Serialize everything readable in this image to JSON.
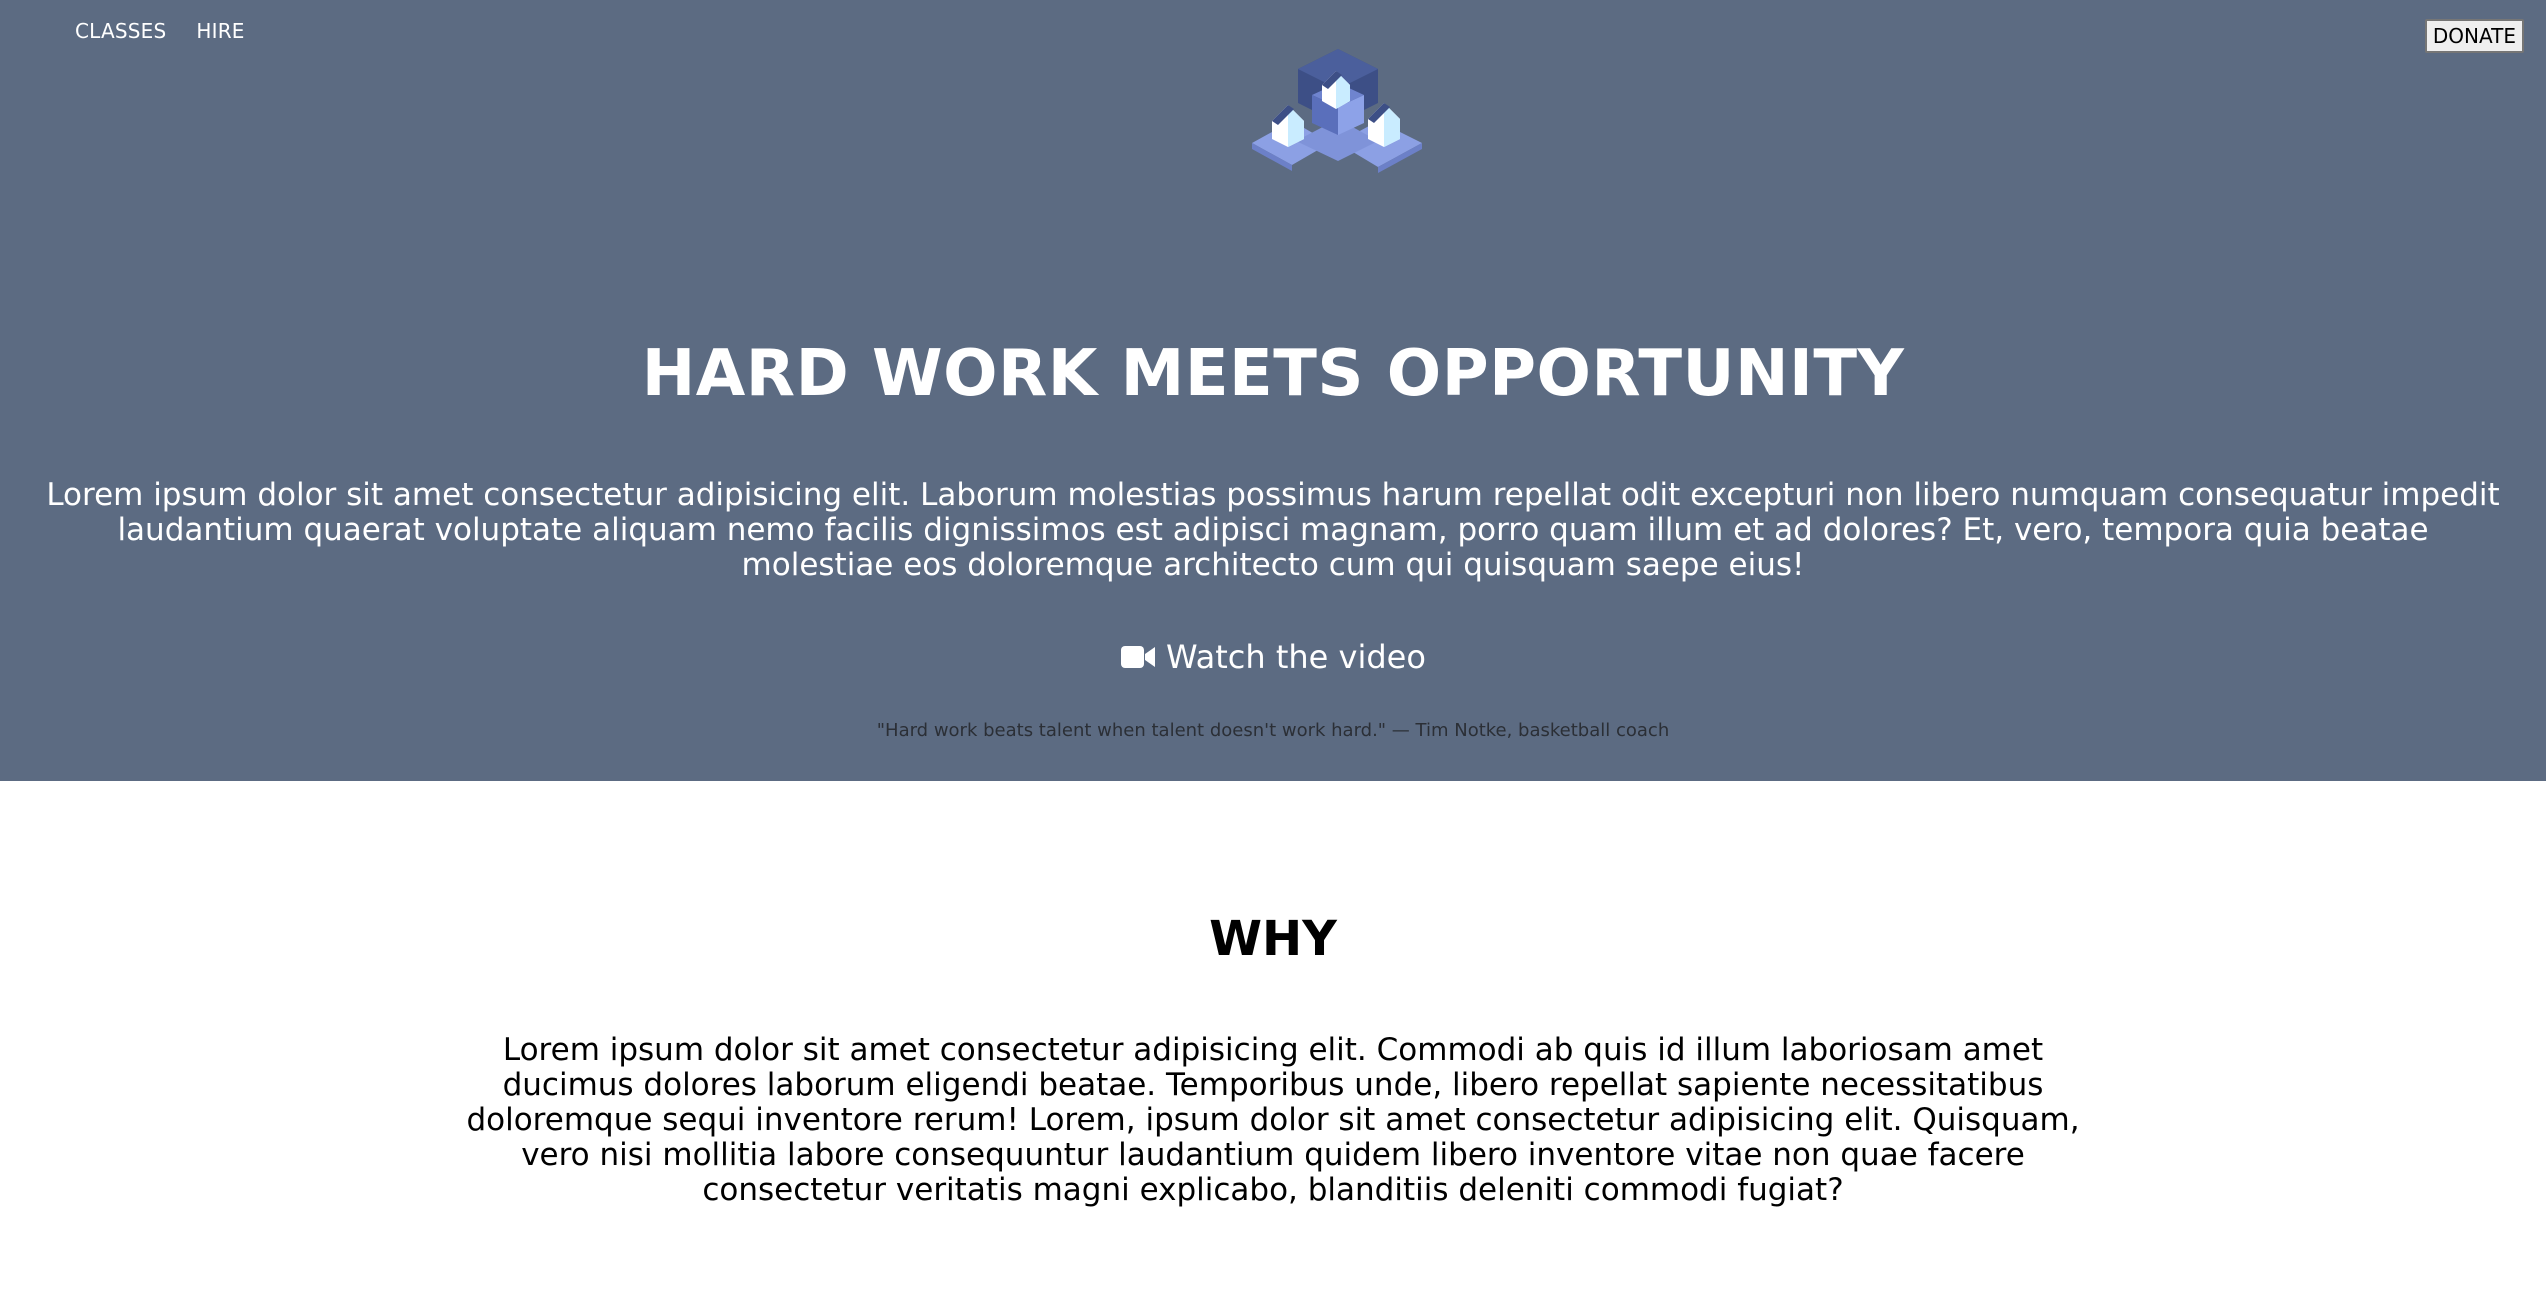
{
  "nav": {
    "items": [
      {
        "label": "CLASSES"
      },
      {
        "label": "HIRE"
      }
    ],
    "donate_label": "DONATE"
  },
  "hero": {
    "title": "HARD WORK MEETS OPPORTUNITY",
    "text": "Lorem ipsum dolor sit amet consectetur adipisicing elit. Laborum molestias possimus harum repellat odit excepturi non libero numquam consequatur impedit laudantium quaerat voluptate aliquam nemo facilis dignissimos est adipisci magnam, porro quam illum et ad dolores? Et, vero, tempora quia beatae molestiae eos doloremque architecto cum qui quisquam saepe eius!",
    "video_label": "Watch the video",
    "video_icon": "video-camera-icon",
    "quote": "\"Hard work beats talent when talent doesn't work hard.\" — Tim Notke, basketball coach"
  },
  "why": {
    "title": "WHY",
    "text": "Lorem ipsum dolor sit amet consectetur adipisicing elit. Commodi ab quis id illum laboriosam amet ducimus dolores laborum eligendi beatae. Temporibus unde, libero repellat sapiente necessitatibus doloremque sequi inventore rerum! Lorem, ipsum dolor sit amet consectetur adipisicing elit. Quisquam, vero nisi mollitia labore consequuntur laudantium quidem libero inventore vitae non quae facere consectetur veritatis magni explicabo, blanditiis deleniti commodi fugiat?"
  },
  "colors": {
    "hero_bg": "#5c6b82",
    "text_light": "#ffffff",
    "text_dark": "#000000",
    "logo_dark": "#3d4f86",
    "logo_mid": "#7f93d9",
    "logo_light": "#c9ecff"
  }
}
